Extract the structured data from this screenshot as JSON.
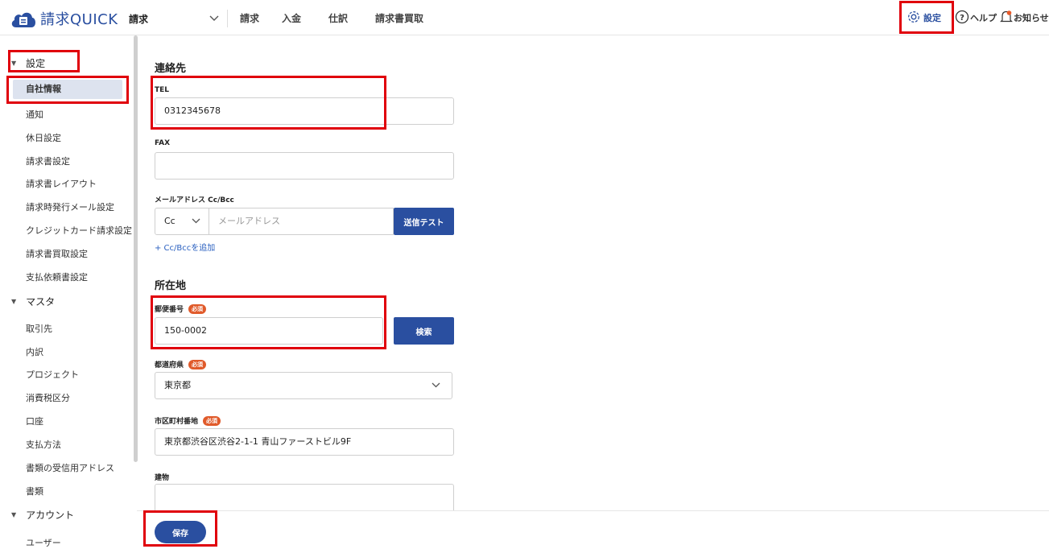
{
  "header": {
    "logo_text": "請求QUICK",
    "product_label": "請求",
    "nav": [
      "請求",
      "入金",
      "仕訳",
      "請求書買取"
    ],
    "settings_label": "設定",
    "help_label": "ヘルプ",
    "notice_label": "お知らせ"
  },
  "sidebar": {
    "groups": [
      {
        "label": "設定",
        "items": [
          "自社情報",
          "通知",
          "休日設定",
          "請求書設定",
          "請求書レイアウト",
          "請求時発行メール設定",
          "クレジットカード請求設定",
          "請求書買取設定",
          "支払依頼書設定"
        ]
      },
      {
        "label": "マスタ",
        "items": [
          "取引先",
          "内訳",
          "プロジェクト",
          "消費税区分",
          "口座",
          "支払方法",
          "書類の受信用アドレス",
          "書類"
        ]
      },
      {
        "label": "アカウント",
        "items": [
          "ユーザー"
        ]
      }
    ]
  },
  "form": {
    "contact_title": "連絡先",
    "tel_label": "TEL",
    "tel_value": "0312345678",
    "fax_label": "FAX",
    "fax_value": "",
    "email_label": "メールアドレス Cc/Bcc",
    "cc_value": "Cc",
    "email_placeholder": "メールアドレス",
    "send_test_label": "送信テスト",
    "add_cc_label": "+ Cc/Bccを追加",
    "address_title": "所在地",
    "postal_label": "郵便番号",
    "required_badge": "必須",
    "postal_value": "150-0002",
    "search_label": "検索",
    "pref_label": "都道府県",
    "pref_value": "東京都",
    "city_label": "市区町村番地",
    "city_value": "東京都渋谷区渋谷2-1-1 青山ファーストビル9F",
    "building_label": "建物",
    "building_value": ""
  },
  "footer": {
    "save_label": "保存"
  },
  "colors": {
    "accent": "#2a4fa0",
    "highlight": "#e0000b",
    "required": "#e05a2a"
  }
}
